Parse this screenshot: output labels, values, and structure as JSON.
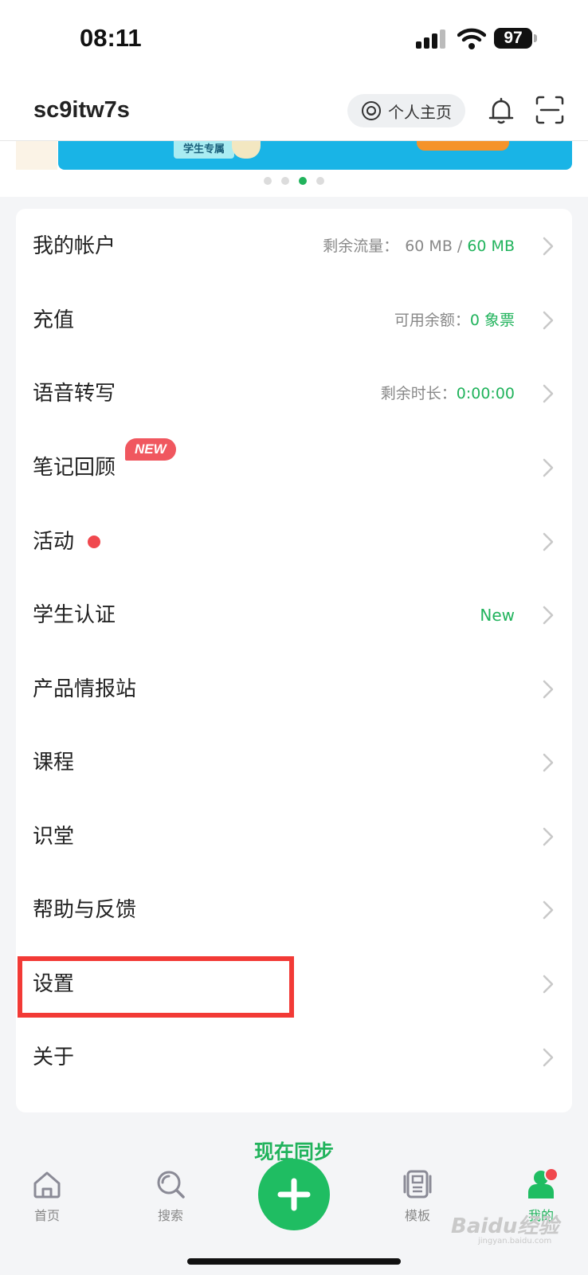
{
  "status_bar": {
    "time": "08:11",
    "battery": "97"
  },
  "header": {
    "username": "sc9itw7s",
    "profile_label": "个人主页"
  },
  "banner": {
    "tag": "学生专属"
  },
  "menu": [
    {
      "label": "我的帐户",
      "detail_prefix": "剩余流量：",
      "detail_value": "60 MB",
      "detail_sep": " / ",
      "detail_total": "60 MB"
    },
    {
      "label": "充值",
      "detail_prefix": "可用余额：",
      "detail_value": "0 象票"
    },
    {
      "label": "语音转写",
      "detail_prefix": "剩余时长：",
      "detail_value": "0:00:00"
    },
    {
      "label": "笔记回顾",
      "badge": "NEW"
    },
    {
      "label": "活动"
    },
    {
      "label": "学生认证",
      "detail_value": "New"
    },
    {
      "label": "产品情报站"
    },
    {
      "label": "课程"
    },
    {
      "label": "识堂"
    },
    {
      "label": "帮助与反馈"
    },
    {
      "label": "设置"
    },
    {
      "label": "关于"
    }
  ],
  "tabbar": {
    "sync_text": "现在同步",
    "tabs": [
      {
        "label": "首页",
        "icon": "home-icon"
      },
      {
        "label": "搜索",
        "icon": "search-icon"
      },
      {
        "label": "模板",
        "icon": "template-icon"
      },
      {
        "label": "我的",
        "icon": "profile-icon"
      }
    ]
  },
  "watermark": {
    "text": "Baidu经验",
    "sub": "jingyan.baidu.com"
  },
  "colors": {
    "accent": "#21b35c",
    "highlight": "#f23a36",
    "badge": "#f0575f"
  }
}
